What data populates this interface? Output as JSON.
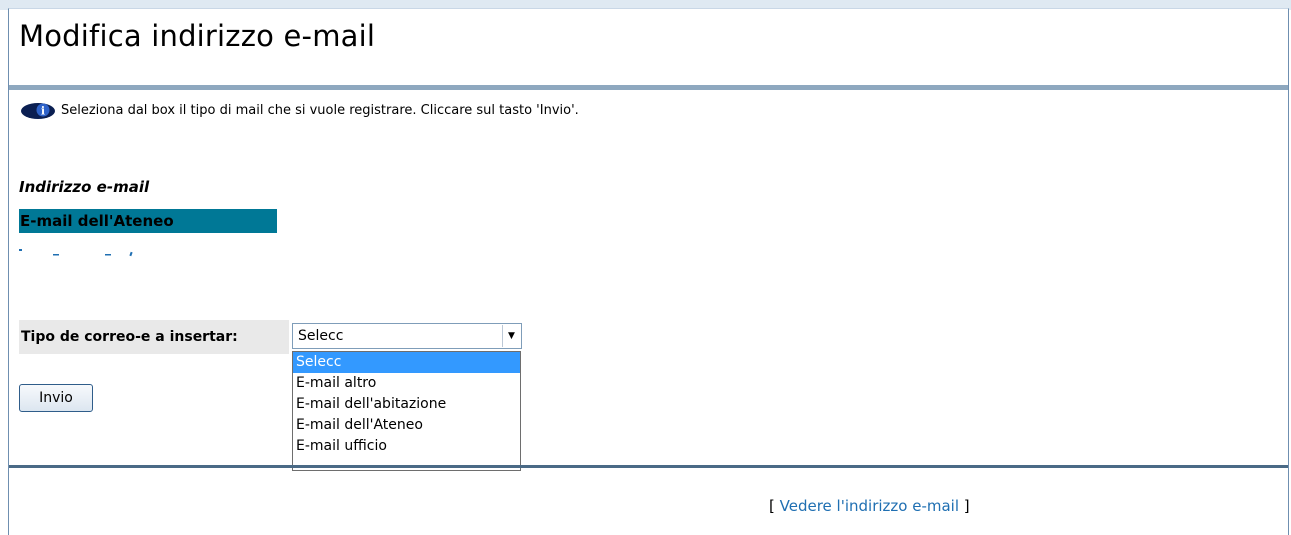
{
  "page": {
    "title": "Modifica indirizzo e-mail",
    "info_text": "Seleziona dal box il tipo di mail che si vuole registrare. Cliccare sul tasto 'Invio'."
  },
  "email_section": {
    "label": "Indirizzo e-mail",
    "header": "E-mail dell'Ateneo"
  },
  "form": {
    "type_label": "Tipo de correo-e a insertar:",
    "select_value": "Selecc",
    "options": [
      "Selecc",
      "E-mail altro",
      "E-mail dell'abitazione",
      "E-mail dell'Ateneo",
      "E-mail ufficio"
    ],
    "submit_label": "Invio"
  },
  "footer": {
    "open_bracket": "[",
    "link": "Vedere l'indirizzo e-mail",
    "close_bracket": "]"
  },
  "icons": {
    "info": "info-icon",
    "dropdown": "chevron-down-icon"
  },
  "colors": {
    "header_bg": "#007896",
    "selected_option": "#3399ff",
    "link": "#1f6fb2",
    "rule": "#8ea8bf"
  }
}
